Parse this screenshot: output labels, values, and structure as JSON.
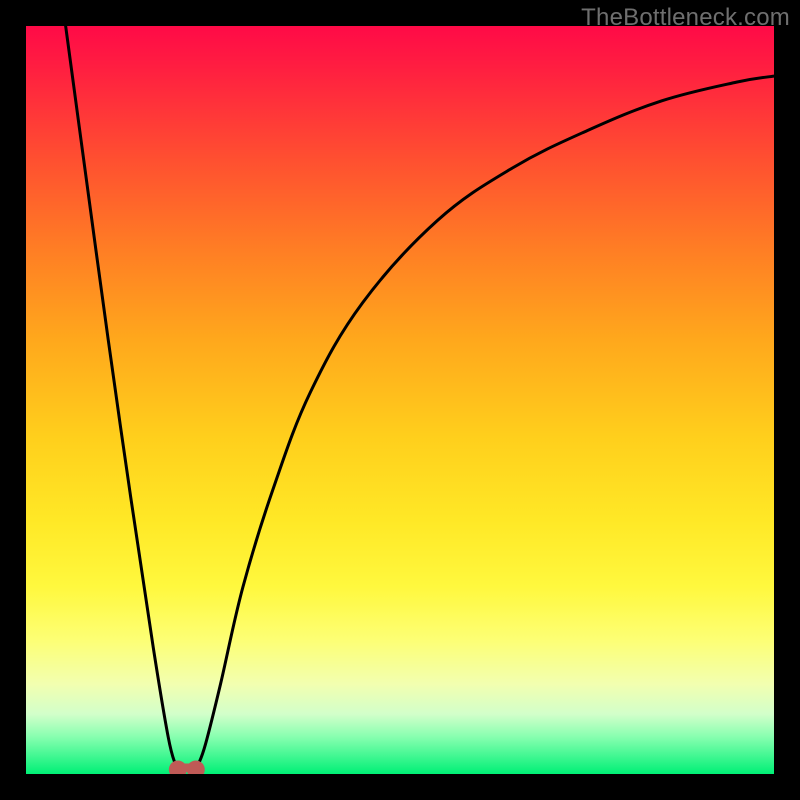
{
  "watermark": "TheBottleneck.com",
  "colors": {
    "frame_border": "#000000",
    "curve_stroke": "#000000",
    "marker_fill": "#bf5a56"
  },
  "chart_data": {
    "type": "line",
    "title": "",
    "xlabel": "",
    "ylabel": "",
    "xlim": [
      0,
      100
    ],
    "ylim": [
      0,
      100
    ],
    "grid": false,
    "legend": false,
    "series": [
      {
        "name": "left-branch",
        "x": [
          5.3,
          8,
          11,
          14,
          17,
          19,
          20,
          20.3
        ],
        "values": [
          100,
          80,
          58,
          37,
          17,
          5,
          1.2,
          0.6
        ]
      },
      {
        "name": "right-branch",
        "x": [
          22.7,
          23,
          24,
          26,
          29,
          33,
          38,
          45,
          55,
          65,
          75,
          85,
          95,
          100
        ],
        "values": [
          0.6,
          1.2,
          4,
          12,
          25,
          38,
          51,
          63,
          74,
          81,
          86,
          90,
          92.5,
          93.3
        ]
      }
    ],
    "markers": [
      {
        "name": "trough-left-dot",
        "x": 20.3,
        "y": 0.6
      },
      {
        "name": "trough-right-dot",
        "x": 22.7,
        "y": 0.6
      }
    ],
    "trough_bar": {
      "x0": 20.3,
      "x1": 22.7,
      "y": 0.3,
      "height": 1.1
    }
  }
}
